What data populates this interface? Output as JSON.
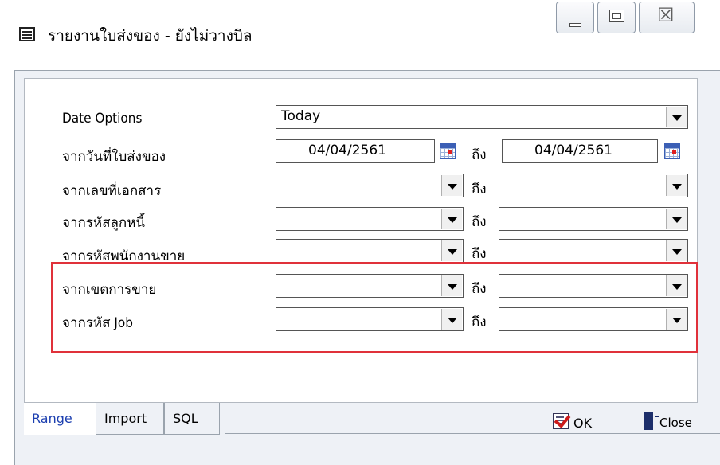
{
  "window": {
    "title": "รายงานใบส่งของ - ยังไม่วางบิล",
    "controls": {
      "minimize": "minimize",
      "maximize": "maximize",
      "close": "close"
    }
  },
  "form": {
    "date_options": {
      "label": "Date Options",
      "value": "Today"
    },
    "rows": [
      {
        "label": "จากวันที่ใบส่งของ",
        "from": "04/04/2561",
        "to_label": "ถึง",
        "to": "04/04/2561"
      },
      {
        "label": "จากเลขที่เอกสาร",
        "from": "",
        "to_label": "ถึง",
        "to": ""
      },
      {
        "label": "จากรหัสลูกหนี้",
        "from": "",
        "to_label": "ถึง",
        "to": ""
      },
      {
        "label": "จากรหัสพนักงานขาย",
        "from": "",
        "to_label": "ถึง",
        "to": ""
      },
      {
        "label": "จากเขตการขาย",
        "from": "",
        "to_label": "ถึง",
        "to": ""
      },
      {
        "label": "จากรหัส Job",
        "from": "",
        "to_label": "ถึง",
        "to": ""
      }
    ]
  },
  "tabs": [
    {
      "label": "Range",
      "active": true
    },
    {
      "label": "Import",
      "active": false
    },
    {
      "label": "SQL",
      "active": false
    }
  ],
  "buttons": {
    "ok": "OK",
    "close": "Close"
  },
  "colors": {
    "highlight": "#e0313a",
    "active_tab": "#1c3fb0",
    "panel": "#eef1f6"
  }
}
